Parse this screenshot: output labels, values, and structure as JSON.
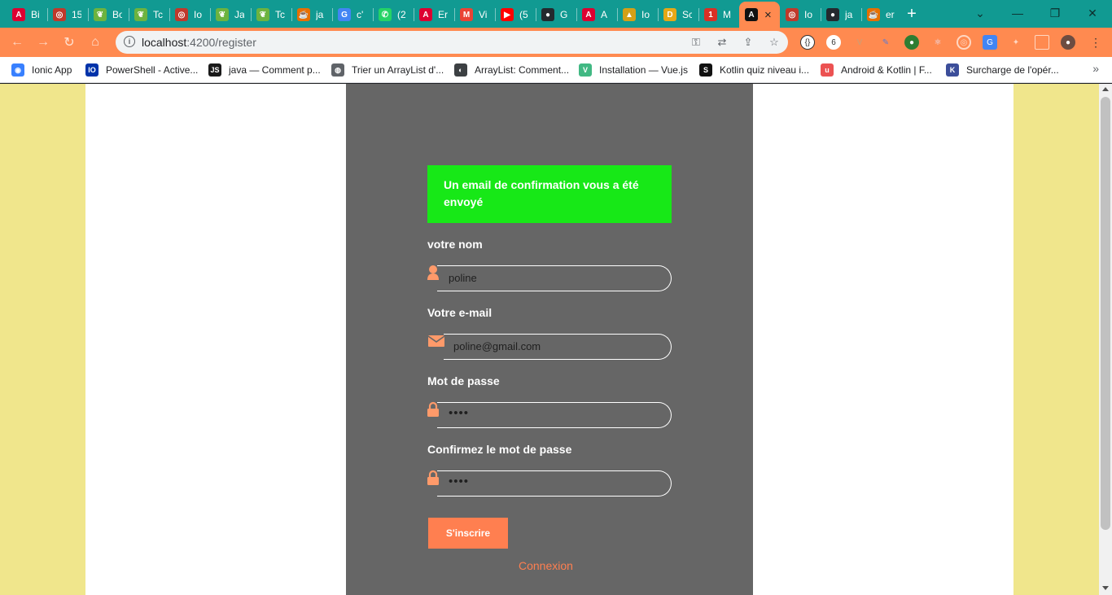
{
  "tabs": [
    {
      "icon": "angular-icon",
      "title": "Bi",
      "color": "#dd0031"
    },
    {
      "icon": "security-icon",
      "title": "15",
      "color": "#c0392b"
    },
    {
      "icon": "spring-icon",
      "title": "Bo",
      "color": "#6db33f"
    },
    {
      "icon": "spring-icon",
      "title": "Tc",
      "color": "#6db33f"
    },
    {
      "icon": "security-icon",
      "title": "Io",
      "color": "#c0392b"
    },
    {
      "icon": "spring-icon",
      "title": "Ja",
      "color": "#6db33f"
    },
    {
      "icon": "spring-icon",
      "title": "Tc",
      "color": "#6db33f"
    },
    {
      "icon": "java-icon",
      "title": "ja",
      "color": "#e76f00"
    },
    {
      "icon": "google-icon",
      "title": "c'",
      "color": "#4285f4"
    },
    {
      "icon": "whatsapp-icon",
      "title": "(2",
      "color": "#25d366"
    },
    {
      "icon": "angular-icon",
      "title": "Er",
      "color": "#dd0031"
    },
    {
      "icon": "gmail-icon",
      "title": "Vi",
      "color": "#ea4335"
    },
    {
      "icon": "youtube-icon",
      "title": "(5",
      "color": "#ff0000"
    },
    {
      "icon": "github-icon",
      "title": "G",
      "color": "#24292e"
    },
    {
      "icon": "angular-icon",
      "title": "A",
      "color": "#dd0031"
    },
    {
      "icon": "wiki-icon",
      "title": "Io",
      "color": "#d4a017"
    },
    {
      "icon": "d-icon",
      "title": "Sc",
      "color": "#e6a817"
    },
    {
      "icon": "calendar-icon",
      "title": "M",
      "color": "#d93025"
    },
    {
      "icon": "angular-icon",
      "title": "×",
      "color": "#111111",
      "active": true
    },
    {
      "icon": "security-icon",
      "title": "Io",
      "color": "#c0392b"
    },
    {
      "icon": "github-icon",
      "title": "ja",
      "color": "#24292e"
    },
    {
      "icon": "java-icon",
      "title": "er",
      "color": "#e76f00"
    }
  ],
  "toolbar": {
    "url_host": "localhost",
    "url_path": ":4200/register"
  },
  "bookmarks": [
    {
      "icon": "ionic-icon",
      "label": "Ionic App",
      "color": "#3880ff"
    },
    {
      "icon": "io-icon",
      "label": "PowerShell - Active...",
      "color": "#0033aa"
    },
    {
      "icon": "js-icon",
      "label": "java — Comment p...",
      "color": "#1a1a1a"
    },
    {
      "icon": "site-icon",
      "label": "Trier un ArrayList d'...",
      "color": "#5f6368"
    },
    {
      "icon": "globe-icon",
      "label": "ArrayList: Comment...",
      "color": "#3c4043"
    },
    {
      "icon": "vue-icon",
      "label": "Installation — Vue.js",
      "color": "#41b883"
    },
    {
      "icon": "kotlin-icon",
      "label": "Kotlin quiz niveau i...",
      "color": "#111111"
    },
    {
      "icon": "udemy-icon",
      "label": "Android & Kotlin | F...",
      "color": "#ec5252"
    },
    {
      "icon": "kotlin-book-icon",
      "label": "Surcharge de l'opér...",
      "color": "#3c4e9a"
    }
  ],
  "page": {
    "alert_text": "Un email de confirmation vous a été envoyé",
    "name_label": "votre nom",
    "name_value": "poline",
    "email_label": "Votre e-mail",
    "email_value": "poline@gmail.com",
    "password_label": "Mot de passe",
    "password_value": "••••",
    "confirm_label": "Confirmez le mot de passe",
    "confirm_value": "••••",
    "submit_label": "S'inscrire",
    "login_link": "Connexion"
  },
  "colors": {
    "tabstrip": "#119a92",
    "toolbar": "#ff8a50",
    "page_bg": "#f0e68c",
    "card": "#666666",
    "alert": "#17e817",
    "accent": "#ff7f50"
  }
}
